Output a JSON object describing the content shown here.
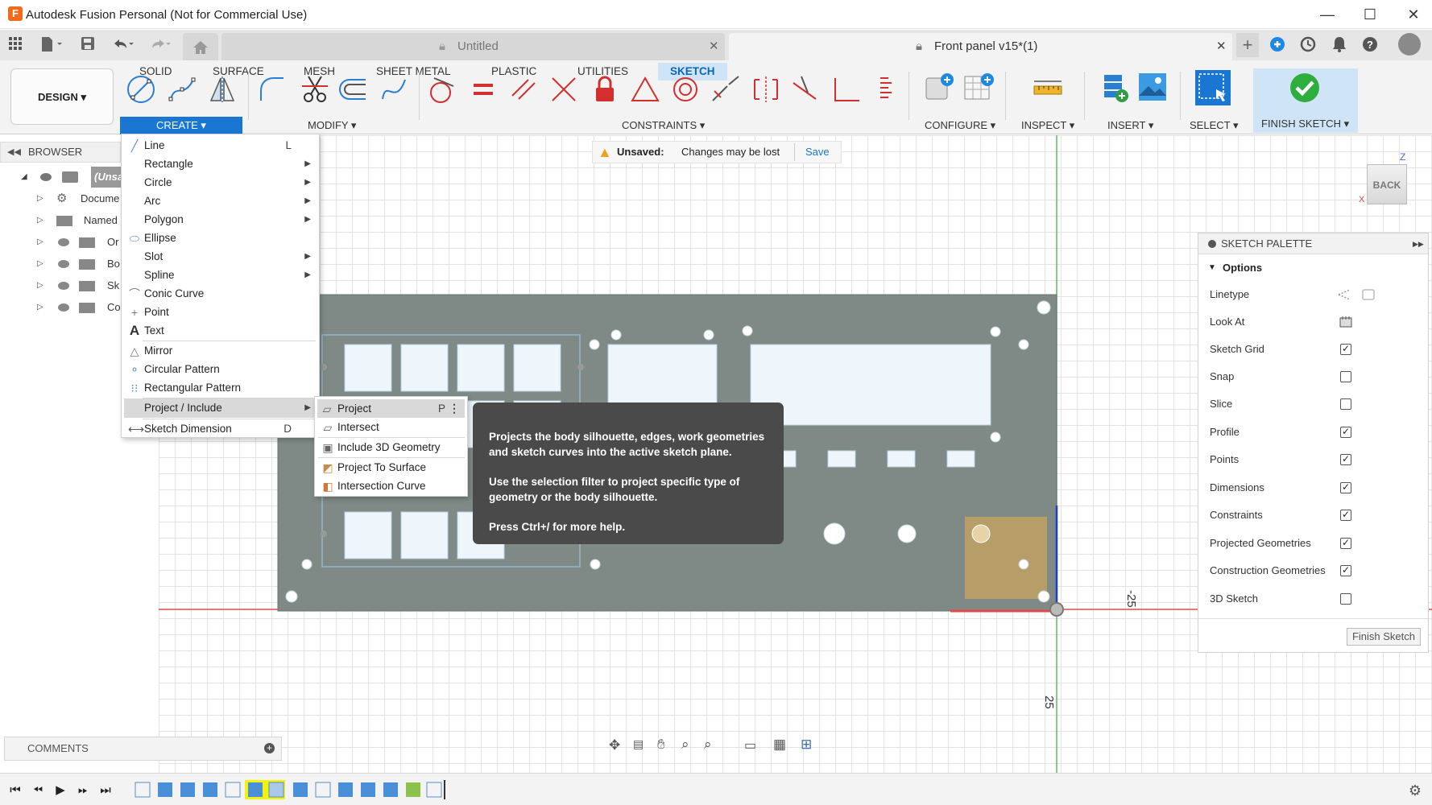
{
  "window": {
    "title": "Autodesk Fusion Personal (Not for Commercial Use)",
    "logo": "F",
    "minimize": "—",
    "maximize": "☐",
    "close": "✕"
  },
  "tabs": [
    {
      "label": "Untitled",
      "close": "✕"
    },
    {
      "label": "Front panel v15*(1)",
      "close": "✕"
    }
  ],
  "workspace": {
    "label": "DESIGN ▾"
  },
  "ribbon_tabs": [
    "SOLID",
    "SURFACE",
    "MESH",
    "SHEET METAL",
    "PLASTIC",
    "UTILITIES",
    "SKETCH"
  ],
  "ribbon_groups": {
    "create": "CREATE ▾",
    "modify": "MODIFY ▾",
    "constraints": "CONSTRAINTS ▾",
    "configure": "CONFIGURE ▾",
    "inspect": "INSPECT ▾",
    "insert": "INSERT ▾",
    "select": "SELECT ▾",
    "finish": "FINISH SKETCH ▾"
  },
  "browser": {
    "title": "BROWSER",
    "items": [
      {
        "label": "(Unsa"
      },
      {
        "label": "Docume"
      },
      {
        "label": "Named"
      },
      {
        "label": "Or"
      },
      {
        "label": "Bo"
      },
      {
        "label": "Sk"
      },
      {
        "label": "Co"
      }
    ]
  },
  "unsaved": {
    "label": "Unsaved:",
    "message": "Changes may be lost",
    "save": "Save"
  },
  "create_menu": [
    {
      "label": "Line",
      "shortcut": "L"
    },
    {
      "label": "Rectangle",
      "arrow": "▶"
    },
    {
      "label": "Circle",
      "arrow": "▶"
    },
    {
      "label": "Arc",
      "arrow": "▶"
    },
    {
      "label": "Polygon",
      "arrow": "▶"
    },
    {
      "label": "Ellipse"
    },
    {
      "label": "Slot",
      "arrow": "▶"
    },
    {
      "label": "Spline",
      "arrow": "▶"
    },
    {
      "label": "Conic Curve"
    },
    {
      "label": "Point"
    },
    {
      "label": "Text"
    },
    {
      "label": "Mirror"
    },
    {
      "label": "Circular Pattern"
    },
    {
      "label": "Rectangular Pattern"
    },
    {
      "label": "Project / Include",
      "arrow": "▶"
    },
    {
      "label": "Sketch Dimension",
      "shortcut": "D"
    }
  ],
  "project_submenu": [
    {
      "label": "Project",
      "shortcut": "P",
      "more": "⋮"
    },
    {
      "label": "Intersect"
    },
    {
      "label": "Include 3D Geometry"
    },
    {
      "label": "Project To Surface"
    },
    {
      "label": "Intersection Curve"
    }
  ],
  "tooltip": {
    "p1": "Projects the body silhouette, edges, work geometries and sketch curves into the active sketch plane.",
    "p2": "Use the selection filter to project specific type of geometry or the body silhouette.",
    "p3": "Press Ctrl+/ for more help."
  },
  "palette": {
    "title": "SKETCH PALETTE",
    "section": "Options",
    "finish": "Finish Sketch",
    "expand": "▶▶",
    "rows": [
      {
        "label": "Linetype",
        "type": "icon"
      },
      {
        "label": "Look At",
        "type": "icon"
      },
      {
        "label": "Sketch Grid",
        "checked": "✓"
      },
      {
        "label": "Snap",
        "checked": ""
      },
      {
        "label": "Slice",
        "checked": ""
      },
      {
        "label": "Profile",
        "checked": "✓"
      },
      {
        "label": "Points",
        "checked": "✓"
      },
      {
        "label": "Dimensions",
        "checked": "✓"
      },
      {
        "label": "Constraints",
        "checked": "✓"
      },
      {
        "label": "Projected Geometries",
        "checked": "✓"
      },
      {
        "label": "Construction Geometries",
        "checked": "✓"
      },
      {
        "label": "3D Sketch",
        "checked": ""
      }
    ]
  },
  "viewcube": {
    "face": "BACK",
    "z": "Z",
    "x": "X"
  },
  "dimensions": {
    "d1": "-25",
    "d2": "25"
  },
  "comments": {
    "label": "COMMENTS",
    "add": "+"
  },
  "colors": {
    "accent": "#1976d2",
    "body": "#7f8a86",
    "hole": "#eef6fb",
    "select": "#c9a45f"
  }
}
